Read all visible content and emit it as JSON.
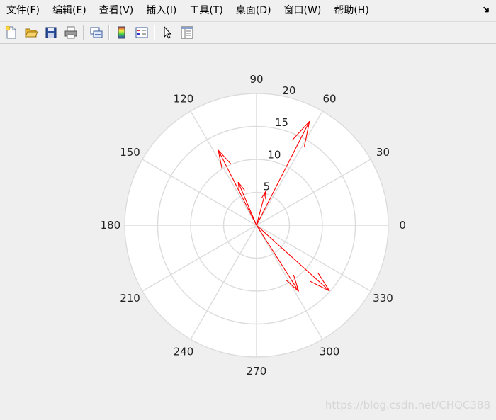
{
  "menu": {
    "items": [
      "文件(F)",
      "编辑(E)",
      "查看(V)",
      "插入(I)",
      "工具(T)",
      "桌面(D)",
      "窗口(W)",
      "帮助(H)"
    ],
    "dock_icon": "dock-arrow-icon"
  },
  "toolbar": {
    "icons": [
      "new-figure-icon",
      "open-file-icon",
      "save-icon",
      "print-icon",
      "link-plot-icon",
      "colorbar-icon",
      "legend-icon",
      "pointer-icon",
      "property-inspector-icon"
    ]
  },
  "chart_data": {
    "type": "compass",
    "title": "",
    "r_ticks": [
      5,
      10,
      15,
      20
    ],
    "rlim": [
      0,
      20
    ],
    "theta_ticks": [
      0,
      30,
      60,
      90,
      120,
      150,
      180,
      210,
      240,
      270,
      300,
      330
    ],
    "grid": true,
    "color": "#ff0000",
    "arrows": [
      {
        "angle": 63.0,
        "r": 17.7
      },
      {
        "angle": 117.0,
        "r": 12.8
      },
      {
        "angle": 113.0,
        "r": 7.1
      },
      {
        "angle": 75.0,
        "r": 5.3
      },
      {
        "angle": -42.0,
        "r": 14.9
      },
      {
        "angle": -57.5,
        "r": 11.9
      }
    ]
  },
  "watermark": "https://blog.csdn.net/CHQC388",
  "colors": {
    "background": "#efefef",
    "axes": "#ffffff",
    "grid": "#dcdcdc",
    "arrow": "#ff0000"
  }
}
